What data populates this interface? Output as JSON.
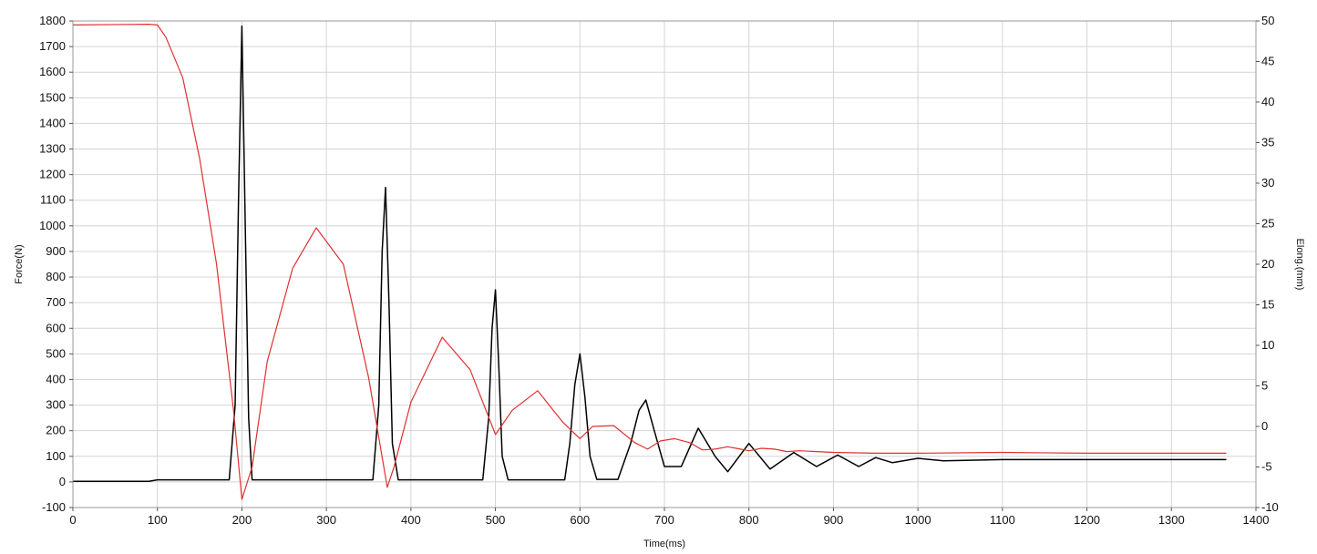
{
  "chart_data": {
    "type": "line",
    "xlabel": "Time(ms)",
    "ylabel": "Force(N)",
    "y2label": "Elong.(mm)",
    "xlim": [
      0,
      1400
    ],
    "ylim": [
      -100,
      1800
    ],
    "y2lim": [
      -10,
      50
    ],
    "xticks": [
      0,
      100,
      200,
      300,
      400,
      500,
      600,
      700,
      800,
      900,
      1000,
      1100,
      1200,
      1300,
      1400
    ],
    "yticks": [
      -100,
      0,
      100,
      200,
      300,
      400,
      500,
      600,
      700,
      800,
      900,
      1000,
      1100,
      1200,
      1300,
      1400,
      1500,
      1600,
      1700,
      1800
    ],
    "y2ticks": [
      -10,
      -5,
      0,
      5,
      10,
      15,
      20,
      25,
      30,
      35,
      40,
      45,
      50
    ],
    "grid": true,
    "series": [
      {
        "axis": "left",
        "color": "#000000",
        "x": [
          0,
          90,
          100,
          185,
          192,
          196,
          200,
          204,
          208,
          212,
          220,
          355,
          362,
          366,
          370,
          374,
          378,
          385,
          485,
          492,
          496,
          500,
          504,
          508,
          515,
          582,
          588,
          594,
          600,
          606,
          612,
          620,
          645,
          660,
          670,
          678,
          688,
          700,
          720,
          740,
          760,
          775,
          800,
          825,
          853,
          880,
          905,
          930,
          950,
          970,
          1000,
          1030,
          1100,
          1200,
          1365
        ],
        "values": [
          2,
          2,
          8,
          8,
          300,
          1100,
          1780,
          1000,
          250,
          8,
          8,
          8,
          300,
          900,
          1150,
          700,
          150,
          8,
          8,
          250,
          600,
          750,
          450,
          100,
          8,
          8,
          150,
          380,
          500,
          330,
          100,
          10,
          10,
          150,
          280,
          320,
          200,
          60,
          60,
          210,
          100,
          40,
          150,
          50,
          115,
          60,
          105,
          60,
          95,
          75,
          92,
          82,
          87,
          87,
          87
        ]
      },
      {
        "axis": "right",
        "color": "#e03030",
        "x": [
          0,
          90,
          100,
          110,
          130,
          150,
          170,
          190,
          200,
          212,
          230,
          260,
          288,
          320,
          350,
          372,
          380,
          400,
          437,
          470,
          500,
          520,
          550,
          580,
          600,
          615,
          640,
          665,
          680,
          695,
          712,
          730,
          745,
          760,
          775,
          790,
          800,
          815,
          830,
          845,
          860,
          880,
          900,
          950,
          1000,
          1100,
          1200,
          1365
        ],
        "values": [
          49.5,
          49.6,
          49.5,
          48,
          43,
          33,
          20,
          2,
          -9,
          -5,
          8,
          19.5,
          24.5,
          20,
          6,
          -7.5,
          -5,
          3,
          11,
          7,
          -1,
          2,
          4.4,
          0.5,
          -1.5,
          0,
          0.1,
          -2,
          -2.8,
          -1.8,
          -1.5,
          -2,
          -2.9,
          -2.8,
          -2.5,
          -2.8,
          -3,
          -2.7,
          -2.8,
          -3.1,
          -3.0,
          -3.1,
          -3.2,
          -3.3,
          -3.3,
          -3.2,
          -3.3,
          -3.3
        ]
      }
    ]
  }
}
